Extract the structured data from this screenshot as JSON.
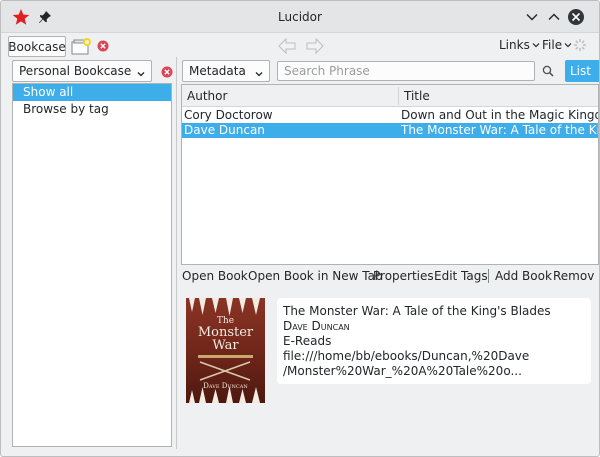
{
  "window": {
    "title": "Lucidor"
  },
  "toolbar": {
    "tab_bookcase": "Bookcase",
    "links_label": "Links",
    "file_label": "File"
  },
  "left": {
    "combo_value": "Personal Bookcase",
    "items": [
      {
        "label": "Show all",
        "selected": true
      },
      {
        "label": "Browse by tag",
        "selected": false
      }
    ]
  },
  "right": {
    "filter_combo": "Metadata",
    "search_placeholder": "Search Phrase",
    "list_button": "List",
    "columns": [
      "Author",
      "Title"
    ],
    "rows": [
      {
        "author": "Cory Doctorow",
        "title": "Down and Out in the Magic Kingdom",
        "selected": false
      },
      {
        "author": "Dave Duncan",
        "title": "The Monster War: A Tale of the King's",
        "selected": true
      }
    ],
    "actions": [
      "Open Book",
      "Open Book in New Tab",
      "Properties",
      "Edit Tags",
      "Add Book",
      "Remov"
    ]
  },
  "details": {
    "title": "The Monster War: A Tale of the King's Blades",
    "author": "Dave Duncan",
    "publisher": "E-Reads",
    "path_line1": "file:///home/bb/ebooks/Duncan,%20Dave",
    "path_line2": "/Monster%20War_%20A%20Tale%20o..."
  },
  "cover": {
    "title_line1": "The",
    "title_line2": "Monster",
    "title_line3": "War",
    "author": "Dave Duncan"
  },
  "colors": {
    "accent": "#3daee9",
    "window_bg": "#eff0f1",
    "close_red": "#da4453"
  }
}
